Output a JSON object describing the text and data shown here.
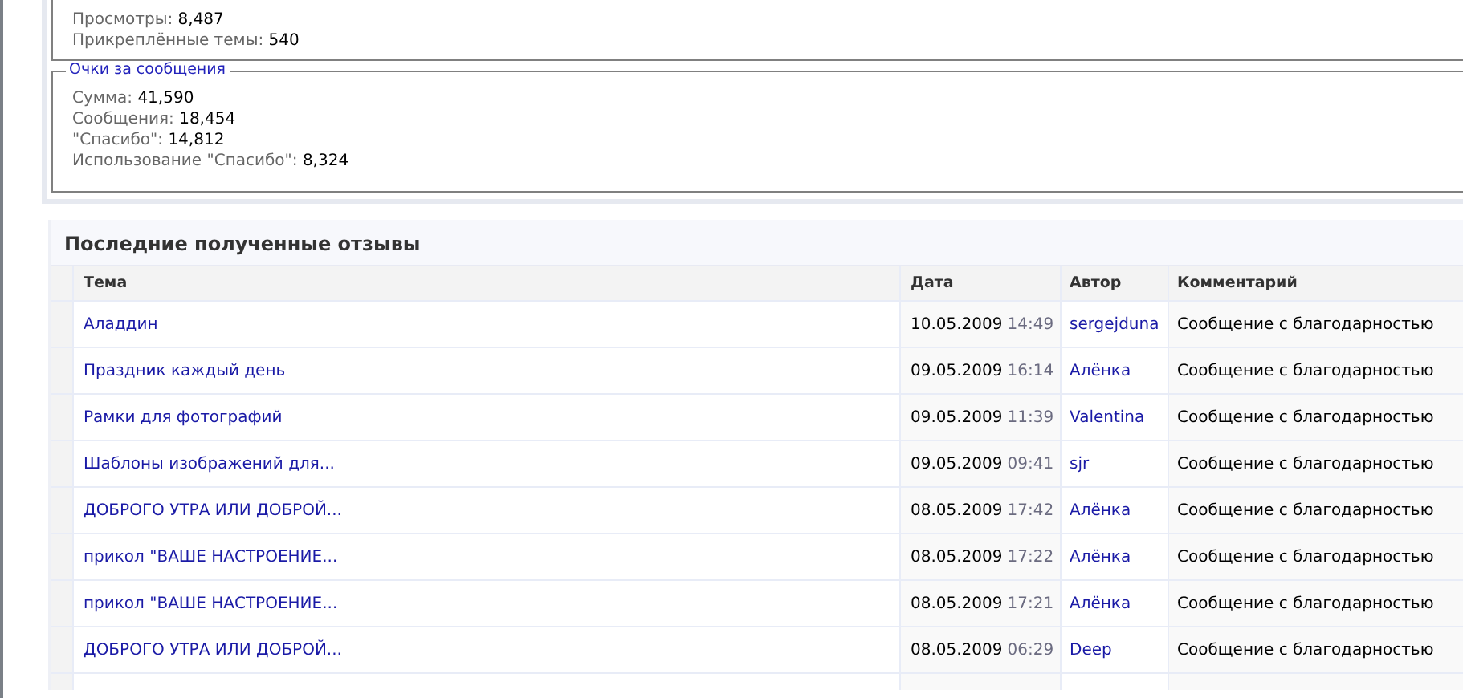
{
  "stats_box": {
    "lines": [
      {
        "label": "Просмотры:",
        "value": "8,487"
      },
      {
        "label": "Прикреплённые темы:",
        "value": "540"
      }
    ]
  },
  "points_box": {
    "legend": "Очки за сообщения",
    "lines": [
      {
        "label": "Сумма:",
        "value": "41,590"
      },
      {
        "label": "Сообщения:",
        "value": "18,454"
      },
      {
        "label": "\"Спасибо\":",
        "value": "14,812"
      },
      {
        "label": "Использование \"Спасибо\":",
        "value": "8,324"
      }
    ]
  },
  "feedback": {
    "title": "Последние полученные отзывы",
    "columns": [
      "Тема",
      "Дата",
      "Автор",
      "Комментарий"
    ],
    "rows": [
      {
        "topic": "Аладдин",
        "date": "10.05.2009",
        "time": "14:49",
        "author": "sergejduna",
        "comment": "Сообщение с благодарностью"
      },
      {
        "topic": "Праздник каждый день",
        "date": "09.05.2009",
        "time": "16:14",
        "author": "Алёнка",
        "comment": "Сообщение с благодарностью"
      },
      {
        "topic": "Рамки для фотографий",
        "date": "09.05.2009",
        "time": "11:39",
        "author": "Valentina",
        "comment": "Сообщение с благодарностью"
      },
      {
        "topic": "Шаблоны изображений для...",
        "date": "09.05.2009",
        "time": "09:41",
        "author": "sjr",
        "comment": "Сообщение с благодарностью"
      },
      {
        "topic": "ДОБРОГО УТРА ИЛИ ДОБРОЙ...",
        "date": "08.05.2009",
        "time": "17:42",
        "author": "Алёнка",
        "comment": "Сообщение с благодарностью"
      },
      {
        "topic": "прикол \"ВАШЕ НАСТРОЕНИЕ...",
        "date": "08.05.2009",
        "time": "17:22",
        "author": "Алёнка",
        "comment": "Сообщение с благодарностью"
      },
      {
        "topic": "прикол \"ВАШЕ НАСТРОЕНИЕ...",
        "date": "08.05.2009",
        "time": "17:21",
        "author": "Алёнка",
        "comment": "Сообщение с благодарностью"
      },
      {
        "topic": "ДОБРОГО УТРА ИЛИ ДОБРОЙ...",
        "date": "08.05.2009",
        "time": "06:29",
        "author": "Deep",
        "comment": "Сообщение с благодарностью"
      }
    ]
  }
}
